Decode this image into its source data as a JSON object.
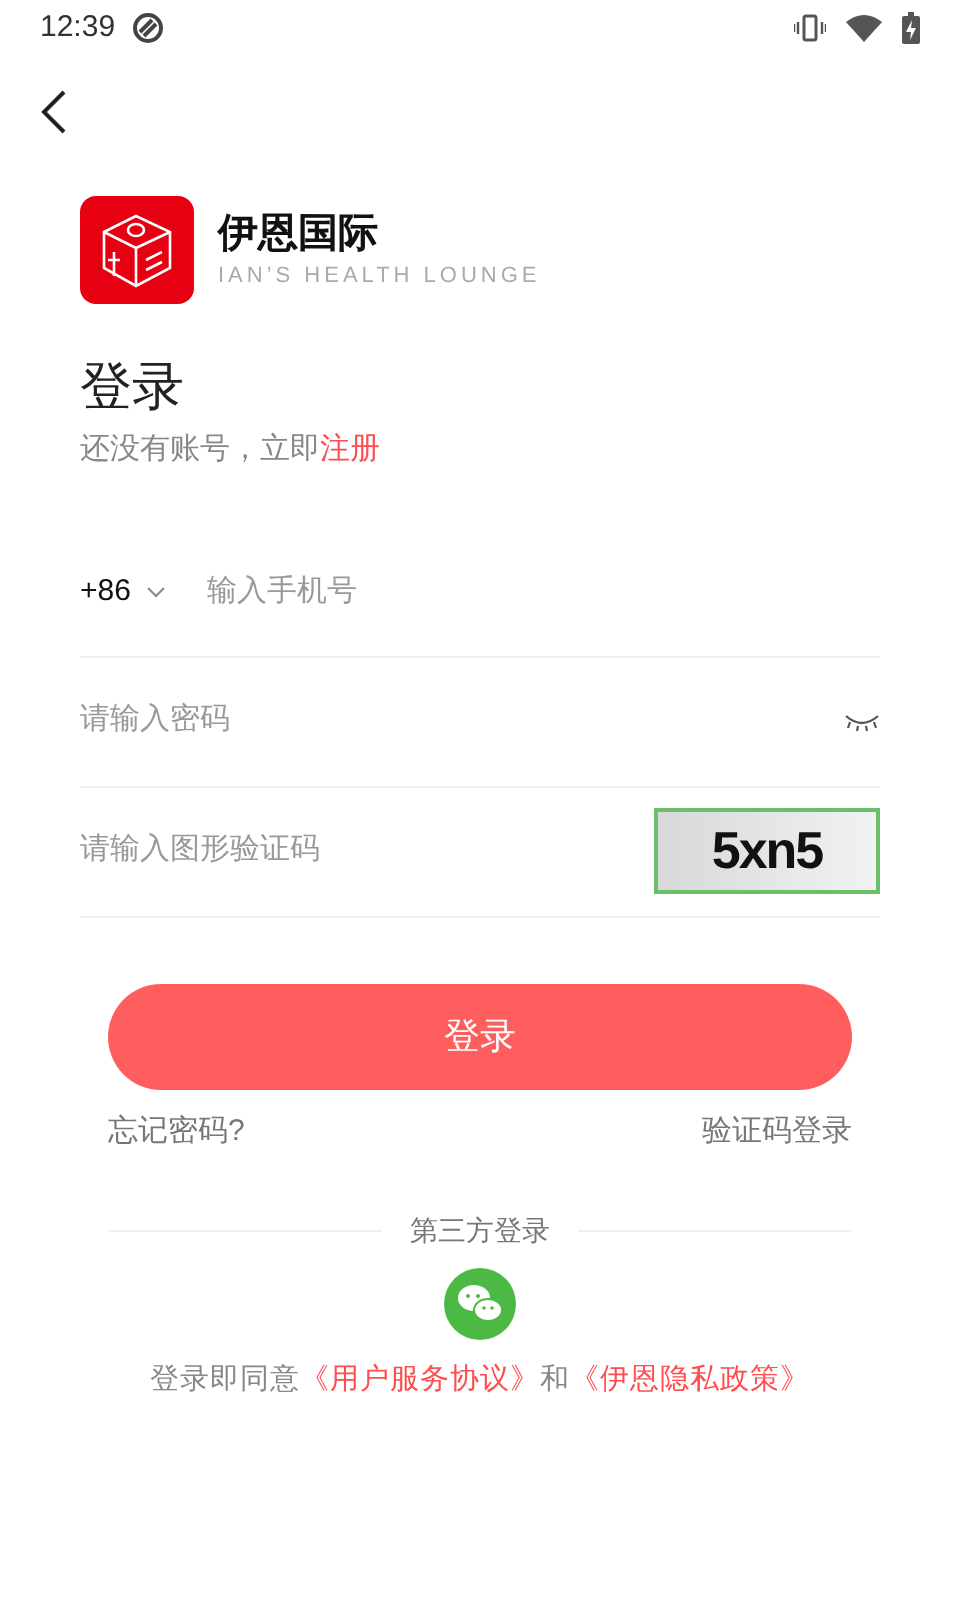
{
  "status_bar": {
    "time": "12:39"
  },
  "brand": {
    "name": "伊恩国际",
    "tagline": "IAN’S HEALTH LOUNGE"
  },
  "title": "登录",
  "register_prompt": {
    "text": "还没有账号，立即",
    "link": "注册"
  },
  "phone": {
    "country_code": "+86",
    "placeholder": "输入手机号"
  },
  "password": {
    "placeholder": "请输入密码",
    "visible": false
  },
  "captcha": {
    "placeholder": "请输入图形验证码",
    "code": "5xn5"
  },
  "login_button": "登录",
  "forgot_link": "忘记密码?",
  "sms_login_link": "验证码登录",
  "third_party_label": "第三方登录",
  "agreement": {
    "text": "登录即同意",
    "link1": "《用户服务协议》",
    "joiner": "和",
    "link2": "《伊恩隐私政策》"
  }
}
